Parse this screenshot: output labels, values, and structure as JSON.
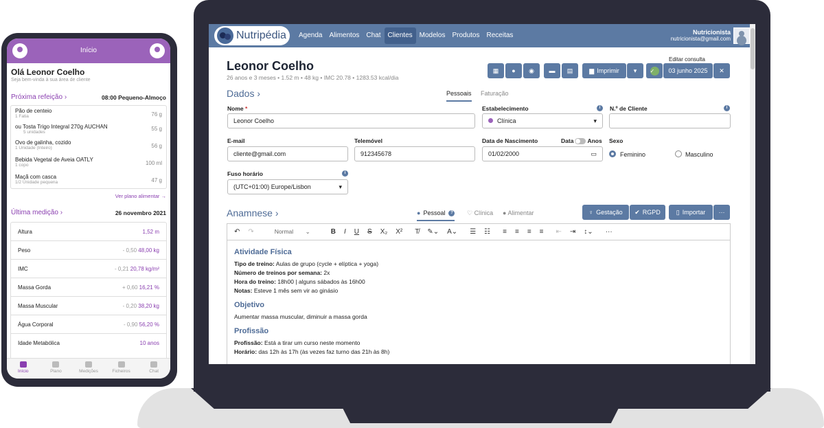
{
  "app": {
    "logo": "Nutripédia",
    "menu": [
      "Agenda",
      "Alimentos",
      "Chat",
      "Clientes",
      "Modelos",
      "Produtos",
      "Receitas"
    ],
    "active_menu": "Clientes",
    "user_role": "Nutricionista",
    "user_email": "nutricionista@gmail.com"
  },
  "client": {
    "name": "Leonor Coelho",
    "summary": "26 anos e 3 meses • 1.52 m • 48 kg • IMC 20.78 • 1283.53 kcal/dia"
  },
  "toolbar": {
    "print": "Imprimir",
    "edit_label": "Editar consulta",
    "date": "03 junho 2025"
  },
  "dados": {
    "title": "Dados",
    "tab_personal": "Pessoais",
    "tab_billing": "Faturação"
  },
  "form": {
    "name_label": "Nome",
    "name": "Leonor Coelho",
    "establishment_label": "Estabelecimento",
    "establishment": "Clínica",
    "client_no_label": "N.º de Cliente",
    "client_no": "",
    "email_label": "E-mail",
    "email": "cliente@gmail.com",
    "phone_label": "Telemóvel",
    "phone": "912345678",
    "birth_label": "Data de Nascimento",
    "birth": "01/02/2000",
    "toggle_data": "Data",
    "toggle_anos": "Anos",
    "sex_label": "Sexo",
    "sex_f": "Feminino",
    "sex_m": "Masculino",
    "tz_label": "Fuso horário",
    "tz": "(UTC+01:00) Europe/Lisbon"
  },
  "anamnese": {
    "title": "Anamnese",
    "tab_personal": "Pessoal",
    "tab_clinical": "Clínica",
    "tab_food": "Alimentar",
    "btn_gest": "Gestação",
    "btn_rgpd": "RGPD",
    "btn_import": "Importar",
    "more": "···"
  },
  "editor": {
    "style": "Normal",
    "h1": "Atividade Física",
    "l1k": "Tipo de treino:",
    "l1v": " Aulas de grupo (cycle + elíptica + yoga)",
    "l2k": "Número de treinos por semana:",
    "l2v": " 2x",
    "l3k": "Hora do treino:",
    "l3v": " 18h00 | alguns sábados às 16h00",
    "l4k": "Notas:",
    "l4v": " Esteve 1 mês sem vir ao ginásio",
    "h2": "Objetivo",
    "p2": "Aumentar massa muscular, diminuir a massa gorda",
    "h3": "Profissão",
    "l5k": "Profissão:",
    "l5v": " Está a tirar um curso neste momento",
    "l6k": "Horário:",
    "l6v": " das 12h às 17h (às vezes faz turno das 21h às 8h)"
  },
  "phone": {
    "header": "Início",
    "greeting": "Olá Leonor Coelho",
    "welcome": "Seja bem-vinda à sua área de cliente",
    "next_meal": "Próxima refeição",
    "next_meal_time": "08:00 Pequeno-Almoço",
    "meals": [
      {
        "name": "Pão de centeio",
        "qty": "1 Fatia",
        "val": "76 g"
      },
      {
        "name": "ou Tosta Trigo Integral 270g AUCHAN",
        "qty": "5 unidades",
        "val": "55 g"
      },
      {
        "name": "Ovo de galinha, cozido",
        "qty": "1 Unidade (Inteiro)",
        "val": "56 g"
      },
      {
        "name": "Bebida Vegetal de Aveia OATLY",
        "qty": "1 copo",
        "val": "100 ml"
      },
      {
        "name": "Maçã com casca",
        "qty": "1/2 Unidade pequena",
        "val": "47 g"
      }
    ],
    "see_plan": "Ver plano alimentar →",
    "last_measure": "Última medição",
    "last_measure_date": "26 novembro 2021",
    "measures": [
      {
        "name": "Altura",
        "delta": "",
        "val": "1,52 m"
      },
      {
        "name": "Peso",
        "delta": "- 0,50",
        "val": "48,00 kg"
      },
      {
        "name": "IMC",
        "delta": "- 0,21",
        "val": "20,78 kg/m²"
      },
      {
        "name": "Massa Gorda",
        "delta": "+ 0,60",
        "val": "16,21 %"
      },
      {
        "name": "Massa Muscular",
        "delta": "- 0,20",
        "val": "38,20 kg"
      },
      {
        "name": "Água Corporal",
        "delta": "- 0,90",
        "val": "56,20 %"
      },
      {
        "name": "Idade Metabólica",
        "delta": "",
        "val": "10 anos"
      }
    ],
    "tabs": [
      "Início",
      "Plano",
      "Medições",
      "Ficheiros",
      "Chat"
    ]
  }
}
